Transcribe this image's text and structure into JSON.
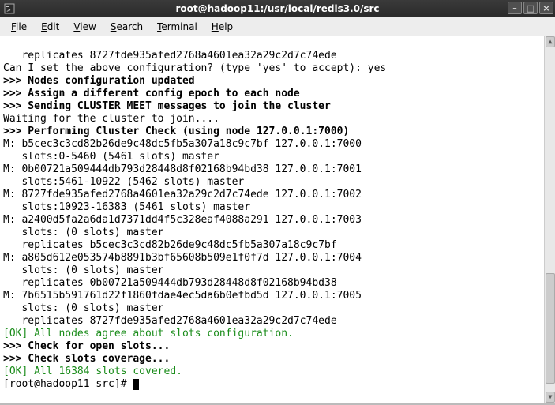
{
  "titlebar": {
    "title": "root@hadoop11:/usr/local/redis3.0/src"
  },
  "menubar": {
    "file": "File",
    "edit": "Edit",
    "view": "View",
    "search": "Search",
    "terminal": "Terminal",
    "help": "Help"
  },
  "terminal": {
    "line_repl_top": "   replicates 8727fde935afed2768a4601ea32a29c2d7c74ede",
    "line_prompt_q": "Can I set the above configuration? (type 'yes' to accept): yes",
    "hdr_nodes_conf": ">>> Nodes configuration updated",
    "hdr_assign_epoch": ">>> Assign a different config epoch to each node",
    "hdr_cluster_meet": ">>> Sending CLUSTER MEET messages to join the cluster",
    "line_waiting": "Waiting for the cluster to join....",
    "hdr_perform_check": ">>> Performing Cluster Check (using node 127.0.0.1:7000)",
    "m1": "M: b5cec3c3cd82b26de9c48dc5fb5a307a18c9c7bf 127.0.0.1:7000",
    "m1s": "   slots:0-5460 (5461 slots) master",
    "m2": "M: 0b00721a509444db793d28448d8f02168b94bd38 127.0.0.1:7001",
    "m2s": "   slots:5461-10922 (5462 slots) master",
    "m3": "M: 8727fde935afed2768a4601ea32a29c2d7c74ede 127.0.0.1:7002",
    "m3s": "   slots:10923-16383 (5461 slots) master",
    "m4": "M: a2400d5fa2a6da1d7371dd4f5c328eaf4088a291 127.0.0.1:7003",
    "m4s": "   slots: (0 slots) master",
    "m4r": "   replicates b5cec3c3cd82b26de9c48dc5fb5a307a18c9c7bf",
    "m5": "M: a805d612e053574b8891b3bf65608b509e1f0f7d 127.0.0.1:7004",
    "m5s": "   slots: (0 slots) master",
    "m5r": "   replicates 0b00721a509444db793d28448d8f02168b94bd38",
    "m6": "M: 7b6515b591761d22f1860fdae4ec5da6b0efbd5d 127.0.0.1:7005",
    "m6s": "   slots: (0 slots) master",
    "m6r": "   replicates 8727fde935afed2768a4601ea32a29c2d7c74ede",
    "ok_agree": "[OK] All nodes agree about slots configuration.",
    "hdr_open_slots": ">>> Check for open slots...",
    "hdr_slots_cov": ">>> Check slots coverage...",
    "ok_covered": "[OK] All 16384 slots covered.",
    "shell_prompt": "[root@hadoop11 src]# "
  }
}
